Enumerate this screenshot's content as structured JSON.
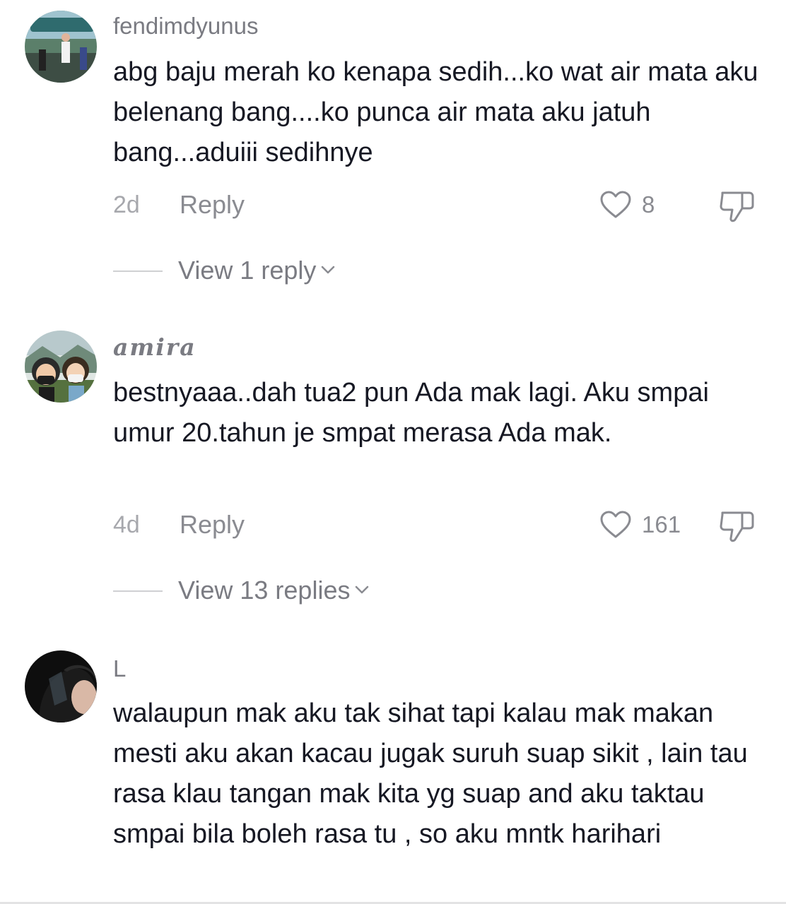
{
  "comments": [
    {
      "username": "fendimdyunus",
      "text": "abg baju merah ko kenapa sedih...ko wat air mata aku belenang bang....ko punca air mata aku jatuh bang...aduiii sedihnye",
      "time": "2d",
      "reply_label": "Reply",
      "likes": "8",
      "view_replies": "View 1 reply"
    },
    {
      "username": "amira",
      "text": "bestnyaaa..dah tua2 pun Ada mak lagi. Aku smpai umur 20.tahun je smpat merasa Ada mak.",
      "time": "4d",
      "reply_label": "Reply",
      "likes": "161",
      "view_replies": "View 13 replies"
    },
    {
      "username": "L",
      "text": "walaupun mak aku tak sihat tapi kalau mak makan mesti aku akan kacau jugak suruh suap sikit , lain tau rasa klau tangan mak kita yg suap and aku taktau smpai bila boleh rasa tu , so aku mntk harihari"
    }
  ],
  "icons": {
    "like": "heart-outline-icon",
    "dislike": "thumbs-down-outline-icon",
    "expand": "chevron-down-icon"
  },
  "colors": {
    "text": "#161823",
    "secondary": "#8a8b91",
    "muted": "#a7a8ad"
  }
}
